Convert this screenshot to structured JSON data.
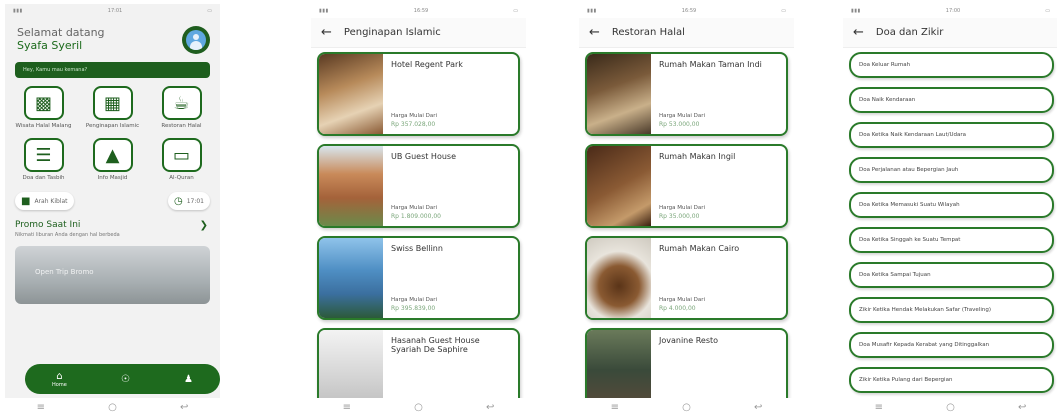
{
  "home": {
    "status_time": "17:01",
    "greeting": "Selamat datang",
    "username": "Syafa Syeril",
    "search_placeholder": "Hey, Kamu mau kemana?",
    "menu": [
      {
        "label": "Wisata Halal Malang",
        "icon": "luggage-icon"
      },
      {
        "label": "Penginapan Islamic",
        "icon": "building-icon"
      },
      {
        "label": "Restoran Halal",
        "icon": "restaurant-icon"
      },
      {
        "label": "Doa dan Tasbih",
        "icon": "book-icon"
      },
      {
        "label": "Info Masjid",
        "icon": "mosque-icon"
      },
      {
        "label": "Al-Quran",
        "icon": "quran-icon"
      }
    ],
    "qibla_label": "Arah Kiblat",
    "clock_label": "17:01",
    "promo_title": "Promo Saat Ini",
    "promo_subtitle": "Nikmati liburan Anda dengan hal berbeda",
    "promo_card_text": "Open Trip Bromo",
    "nav": {
      "home": "Home"
    }
  },
  "hotels": {
    "status_time": "16:59",
    "title": "Penginapan Islamic",
    "price_from": "Harga Mulai Dari",
    "items": [
      {
        "name": "Hotel Regent Park",
        "price": "Rp 357.028,00"
      },
      {
        "name": "UB Guest House",
        "price": "Rp 1.809.000,00"
      },
      {
        "name": "Swiss Bellinn",
        "price": "Rp 395.839,00"
      },
      {
        "name": "Hasanah Guest House Syariah De Saphire",
        "price": ""
      }
    ]
  },
  "restaurants": {
    "status_time": "16:59",
    "title": "Restoran Halal",
    "price_from": "Harga Mulai Dari",
    "items": [
      {
        "name": "Rumah Makan Taman Indi",
        "price": "Rp 53.000,00"
      },
      {
        "name": "Rumah Makan Ingil",
        "price": "Rp 35.000,00"
      },
      {
        "name": "Rumah Makan Cairo",
        "price": "Rp 4.000,00"
      },
      {
        "name": "Jovanine Resto",
        "price": ""
      }
    ]
  },
  "doa": {
    "status_time": "17:00",
    "title": "Doa dan Zikir",
    "items": [
      "Doa Keluar Rumah",
      "Doa Naik Kendaraan",
      "Doa Ketika Naik Kendaraan Laut/Udara",
      "Doa Perjalanan atau Bepergian Jauh",
      "Doa Ketika Memasuki Suatu Wilayah",
      "Doa Ketika Singgah ke Suatu Tempat",
      "Doa Ketika Sampai Tujuan",
      "Zikir Ketika Hendak Melakukan Safar (Traveling)",
      "Doa Musafir Kepada Kerabat yang Ditinggalkan",
      "Zikir Ketika Pulang dari Bepergian"
    ]
  }
}
